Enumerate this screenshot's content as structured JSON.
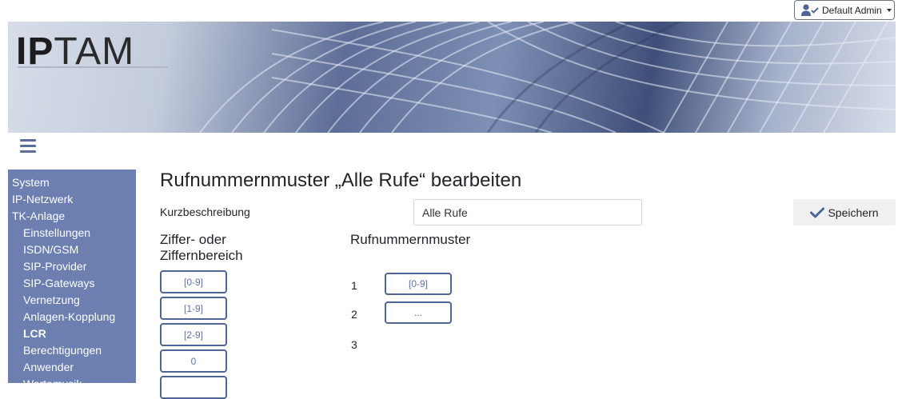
{
  "user": {
    "name": "Default Admin",
    "icon": "user-check-icon"
  },
  "logo": {
    "bold": "IP",
    "rest": "TAM"
  },
  "sidebar": {
    "items": [
      {
        "label": "System",
        "level": "top"
      },
      {
        "label": "IP-Netzwerk",
        "level": "top"
      },
      {
        "label": "TK-Anlage",
        "level": "top"
      },
      {
        "label": "Einstellungen",
        "level": "sub"
      },
      {
        "label": "ISDN/GSM",
        "level": "sub"
      },
      {
        "label": "SIP-Provider",
        "level": "sub"
      },
      {
        "label": "SIP-Gateways",
        "level": "sub"
      },
      {
        "label": "Vernetzung",
        "level": "sub"
      },
      {
        "label": "Anlagen-Kopplung",
        "level": "sub"
      },
      {
        "label": "LCR",
        "level": "sub",
        "active": true
      },
      {
        "label": "Berechtigungen",
        "level": "sub"
      },
      {
        "label": "Anwender",
        "level": "sub"
      },
      {
        "label": "Wartemusik",
        "level": "sub"
      }
    ]
  },
  "main": {
    "title": "Rufnummernmuster „Alle Rufe“ bearbeiten",
    "kurz_label": "Kurzbeschreibung",
    "kurz_value": "Alle Rufe",
    "save_label": "Speichern",
    "left_header": "Ziffer- oder Ziffernbereich",
    "right_header": "Rufnummernmuster",
    "digit_buttons": [
      "[0-9]",
      "[1-9]",
      "[2-9]",
      "0",
      ""
    ],
    "pattern_rows": [
      {
        "num": "1",
        "value": "[0-9]"
      },
      {
        "num": "2",
        "value": "..."
      },
      {
        "num": "3",
        "value": ""
      }
    ]
  },
  "colors": {
    "sidebar": "#6c7fb0",
    "accent": "#4f6596",
    "button_text": "#5e73a8"
  }
}
